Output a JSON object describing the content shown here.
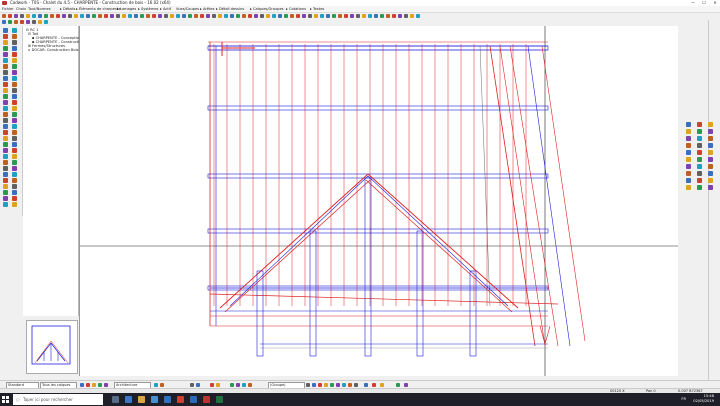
{
  "window": {
    "title": "Cadwork - T0S - Chalet du 4.5 - CHARPENTE - Construction de bois - 16.02 (x64)",
    "controls": [
      "—",
      "☐",
      "✕"
    ]
  },
  "menu": [
    "Fichier",
    "Choix",
    "Tout/Normes",
    "▸ Détails",
    "▸ Éléments de charpente",
    "▸ Lamages",
    "▸ Systèmes",
    "▸ Actif",
    "Vues/Coupes",
    "▸ Arêtes",
    "▸ Détail dessins",
    "▸ Calques/Groupes",
    "▸ Cotations",
    "▸ Textes"
  ],
  "tree": {
    "items": [
      "RC 1",
      "Toit",
      "CHARPENTE - Conception",
      "CHARPENTE - Construction",
      "Fermes/Structures",
      "DOCAR: Construction Bois"
    ]
  },
  "bottom": {
    "layer_select": "Standard",
    "calques_select": "Tous les calques",
    "view_select": "Architecture",
    "group_select": "(Groupe)"
  },
  "status": {
    "left": "",
    "coord1": "00120 X",
    "coord2": "Pan 0",
    "coord3": "0.007 B72367"
  },
  "taskbar": {
    "search_placeholder": "Taper ici pour rechercher",
    "time": "15:48",
    "date": "02/05/2019",
    "lang": "FR"
  },
  "colors": {
    "drawing_red": "#e02020",
    "drawing_blue": "#1e1edc",
    "taskbar": "#1f1f2a"
  }
}
